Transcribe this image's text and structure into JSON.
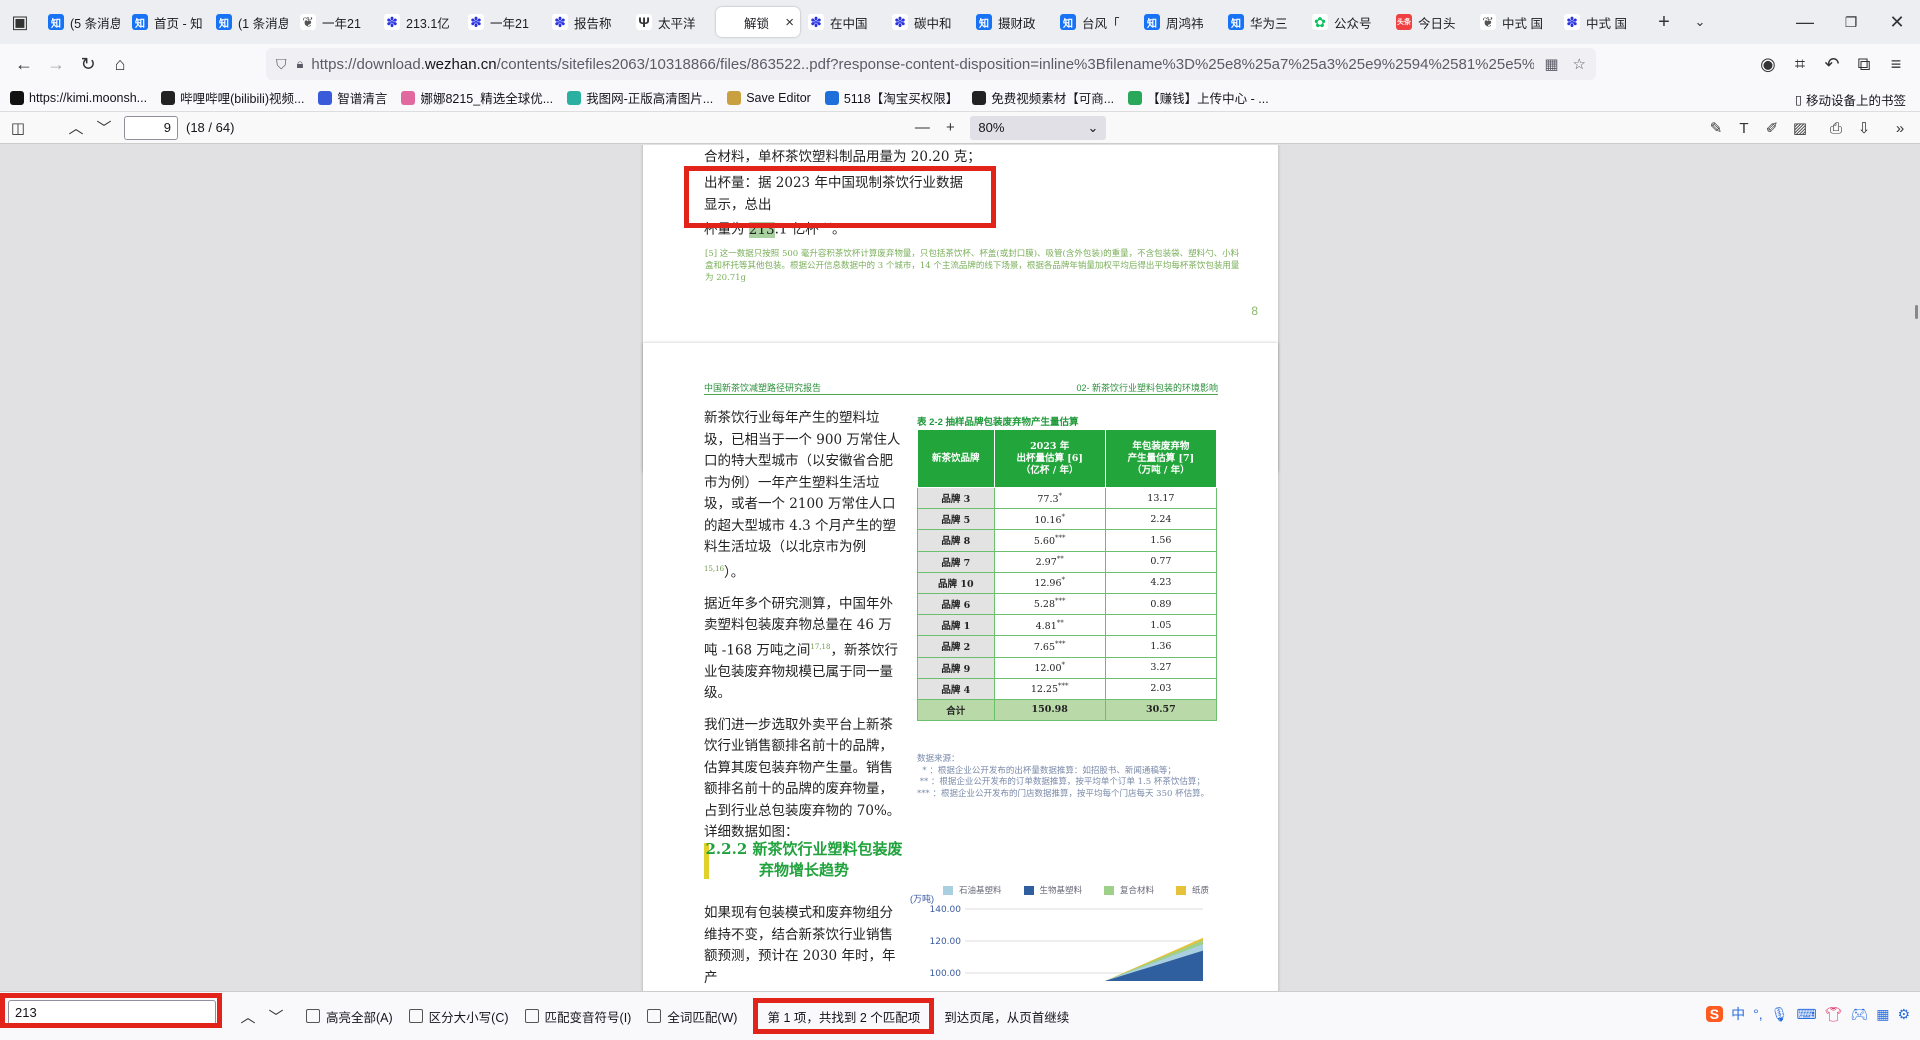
{
  "browser": {
    "tabs": [
      {
        "icon": "zhihu-icon",
        "cls": "zhi",
        "glyph": "知",
        "label": "(5 条消息"
      },
      {
        "icon": "zhihu-icon",
        "cls": "zhi",
        "glyph": "知",
        "label": "首页 - 知"
      },
      {
        "icon": "zhihu-icon",
        "cls": "zhi",
        "glyph": "知",
        "label": "(1 条消息"
      },
      {
        "icon": "page-icon",
        "cls": "ms",
        "glyph": "❦",
        "label": "一年21"
      },
      {
        "icon": "baidu-icon",
        "cls": "baidu",
        "glyph": "✽",
        "label": "213.1亿"
      },
      {
        "icon": "baidu-icon",
        "cls": "baidu",
        "glyph": "✽",
        "label": "一年21"
      },
      {
        "icon": "baidu-icon",
        "cls": "baidu",
        "glyph": "✽",
        "label": "报告称"
      },
      {
        "icon": "page-icon",
        "cls": "tp",
        "glyph": "Ψ",
        "label": "太平洋"
      },
      {
        "icon": "active-tab",
        "cls": "ms",
        "glyph": "",
        "label": "解锁",
        "active": true
      },
      {
        "icon": "baidu-icon",
        "cls": "baidu",
        "glyph": "✽",
        "label": "在中国"
      },
      {
        "icon": "baidu-icon",
        "cls": "baidu",
        "glyph": "✽",
        "label": "碳中和"
      },
      {
        "icon": "zhihu-icon",
        "cls": "zhi",
        "glyph": "知",
        "label": "摄财政"
      },
      {
        "icon": "zhihu-icon",
        "cls": "zhi",
        "glyph": "知",
        "label": "台风「"
      },
      {
        "icon": "zhihu-icon",
        "cls": "zhi",
        "glyph": "知",
        "label": "周鸿祎"
      },
      {
        "icon": "zhihu-icon",
        "cls": "zhi",
        "glyph": "知",
        "label": "华为三"
      },
      {
        "icon": "wechat-icon",
        "cls": "wx",
        "glyph": "✿",
        "label": "公众号"
      },
      {
        "icon": "toutiao-icon",
        "cls": "tt",
        "glyph": "头条",
        "label": "今日头"
      },
      {
        "icon": "page-icon",
        "cls": "ms",
        "glyph": "❦",
        "label": "中式 国"
      },
      {
        "icon": "baidu-icon",
        "cls": "baidu",
        "glyph": "✽",
        "label": "中式 国"
      }
    ],
    "url_prefix": "https://download.",
    "url_domain": "wezhan.cn",
    "url_rest": "/contents/sitefiles2063/10318866/files/863522..pdf?response-content-disposition=inline%3Bfilename%3D%25e8%25a7%25a3%25e9%2594%2581%25e5%25",
    "bookmarks": [
      {
        "label": "https://kimi.moonsh...",
        "color": "#111"
      },
      {
        "label": "哔哩哔哩(bilibili)视频...",
        "color": "#222"
      },
      {
        "label": "智谱清言",
        "color": "#3a5bd9"
      },
      {
        "label": "娜娜8215_精选全球优...",
        "color": "#e06aa0"
      },
      {
        "label": "我图网-正版高清图片...",
        "color": "#2ab0a0"
      },
      {
        "label": "Save Editor",
        "color": "#c8a040"
      },
      {
        "label": "5118【淘宝买权限】",
        "color": "#1e6fd9"
      },
      {
        "label": "免费视频素材【可商...",
        "color": "#222"
      },
      {
        "label": "【赚钱】上传中心 - ...",
        "color": "#2aa85a"
      }
    ],
    "mobile_bookmarks": "移动设备上的书签"
  },
  "pdf_toolbar": {
    "page_number": "9",
    "page_count": "(18 / 64)",
    "zoom": "80%"
  },
  "page8": {
    "line_top": "合材料，单杯茶饮塑料制品用量为 20.20 克；",
    "p1_a": "出杯量：据 2023 年中国现制茶饮行业数据显示，总出",
    "p1_b_pre": "杯量为 ",
    "p1_b_hl": "213",
    "p1_b_post": ".1 亿杯 ",
    "p1_sup": "14",
    "p1_end": "。",
    "footnote": "[5] 这一数据只按照 500 毫升容积茶饮杯计算废弃物量，只包括茶饮杯、杯盖(或封口膜)、吸管(含外包装)的重量，不含包装袋、塑料勺、小料盒和杯托等其他包装。根据公开信息数据中的 3 个城市，14 个主流品牌的线下场景，根据各品牌年销量加权平均后得出平均每杯茶饮包装用量为 20.71g",
    "page_num": "8"
  },
  "page9": {
    "header_left": "中国新茶饮减塑路径研究报告",
    "header_right": "02- 新茶饮行业塑料包装的环境影响",
    "para1": "新茶饮行业每年产生的塑料垃圾，已相当于一个 900 万常住人口的特大型城市（以安徽省合肥市为例）一年产生塑料生活垃圾，或者一个 2100 万常住人口的超大型城市 4.3 个月产生的塑料生活垃圾（以北京市为例",
    "para1_sup": "15,16",
    "para1_end": "）。",
    "para2": "据近年多个研究测算，中国年外卖塑料包装废弃物总量在 46 万吨 -168 万吨之间",
    "para2_sup": "17,18",
    "para2_end": "，新茶饮行业包装废弃物规模已属于同一量级。",
    "para3": "我们进一步选取外卖平台上新茶饮行业销售额排名前十的品牌，估算其废包装弃物产生量。销售额排名前十的品牌的废弃物量，占到行业总包装废弃物的 70%。详细数据如图：",
    "section_title": "2.2.2 新茶饮行业塑料包装废弃物增长趋势",
    "para4": "如果现有包装模式和废弃物组分维持不变，结合新茶饮行业销售额预测，预计在 2030 年时，年产",
    "table_caption": "表 2-2 抽样品牌包装废弃物产生量估算",
    "table_headers": [
      "新茶饮品牌",
      "2023 年\n出杯量估算 [6]\n（亿杯 / 年）",
      "年包装废弃物\n产生量估算 [7]\n（万吨 / 年）"
    ],
    "table_rows": [
      {
        "brand": "品牌 3",
        "cups": "77.3",
        "mark": "*",
        "waste": "13.17"
      },
      {
        "brand": "品牌 5",
        "cups": "10.16",
        "mark": "*",
        "waste": "2.24"
      },
      {
        "brand": "品牌 8",
        "cups": "5.60",
        "mark": "***",
        "waste": "1.56"
      },
      {
        "brand": "品牌 7",
        "cups": "2.97",
        "mark": "**",
        "waste": "0.77"
      },
      {
        "brand": "品牌 10",
        "cups": "12.96",
        "mark": "*",
        "waste": "4.23"
      },
      {
        "brand": "品牌 6",
        "cups": "5.28",
        "mark": "***",
        "waste": "0.89"
      },
      {
        "brand": "品牌 1",
        "cups": "4.81",
        "mark": "**",
        "waste": "1.05"
      },
      {
        "brand": "品牌 2",
        "cups": "7.65",
        "mark": "***",
        "waste": "1.36"
      },
      {
        "brand": "品牌 9",
        "cups": "12.00",
        "mark": "*",
        "waste": "3.27"
      },
      {
        "brand": "品牌 4",
        "cups": "12.25",
        "mark": "***",
        "waste": "2.03"
      }
    ],
    "table_total": {
      "brand": "合计",
      "cups": "150.98",
      "waste": "30.57"
    },
    "table_notes": [
      "数据来源：",
      "  * ：根据企业公开发布的出杯量数据推算：如招股书、新闻通稿等；",
      " ** ：根据企业公开发布的订单数据推算，按平均单个订单 1.5 杯茶饮估算；",
      "*** ：根据企业公开发布的门店数据推算，按平均每个门店每天 350 杯估算。"
    ]
  },
  "chart_data": {
    "type": "area",
    "ylabel": "(万吨)",
    "y_ticks": [
      "140.00",
      "120.00",
      "100.00"
    ],
    "series": [
      {
        "name": "石油基塑料",
        "color": "#a9cfe0"
      },
      {
        "name": "生物基塑料",
        "color": "#2f5f9e"
      },
      {
        "name": "复合材料",
        "color": "#9fd08a"
      },
      {
        "name": "纸质",
        "color": "#e6c23a"
      }
    ],
    "visible_top_value": 122
  },
  "find_bar": {
    "query": "213",
    "highlight_all": "高亮全部(A)",
    "match_case": "区分大小写(C)",
    "match_diacritics": "匹配变音符号(I)",
    "whole_words": "全词匹配(W)",
    "result": "第 1 项，共找到 2 个匹配项",
    "wrap_status": "到达页尾，从页首继续"
  }
}
